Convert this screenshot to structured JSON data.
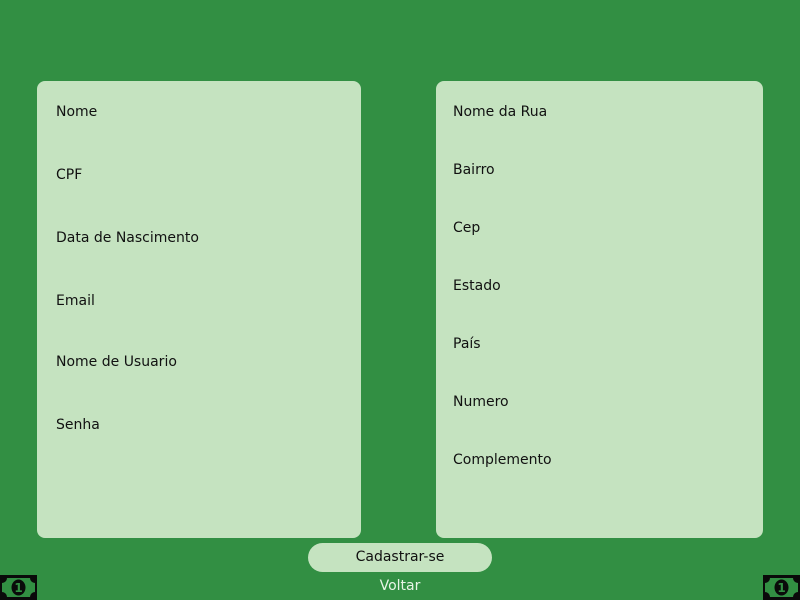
{
  "form": {
    "personal_fields": [
      {
        "label": "Nome"
      },
      {
        "label": "CPF"
      },
      {
        "label": "Data de Nascimento"
      },
      {
        "label": "Email"
      },
      {
        "label": "Nome de Usuario"
      },
      {
        "label": "Senha"
      }
    ],
    "address_fields": [
      {
        "label": "Nome da Rua"
      },
      {
        "label": "Bairro"
      },
      {
        "label": "Cep"
      },
      {
        "label": "Estado"
      },
      {
        "label": "País"
      },
      {
        "label": "Numero"
      },
      {
        "label": "Complemento"
      }
    ],
    "submit_label": "Cadastrar-se",
    "back_label": "Voltar"
  },
  "decor": {
    "left_icon": "money-bill-icon",
    "right_icon": "money-bill-icon",
    "icon_number": "1"
  },
  "colors": {
    "background": "#328F43",
    "panel": "#C5E3C0",
    "text": "#111111"
  }
}
